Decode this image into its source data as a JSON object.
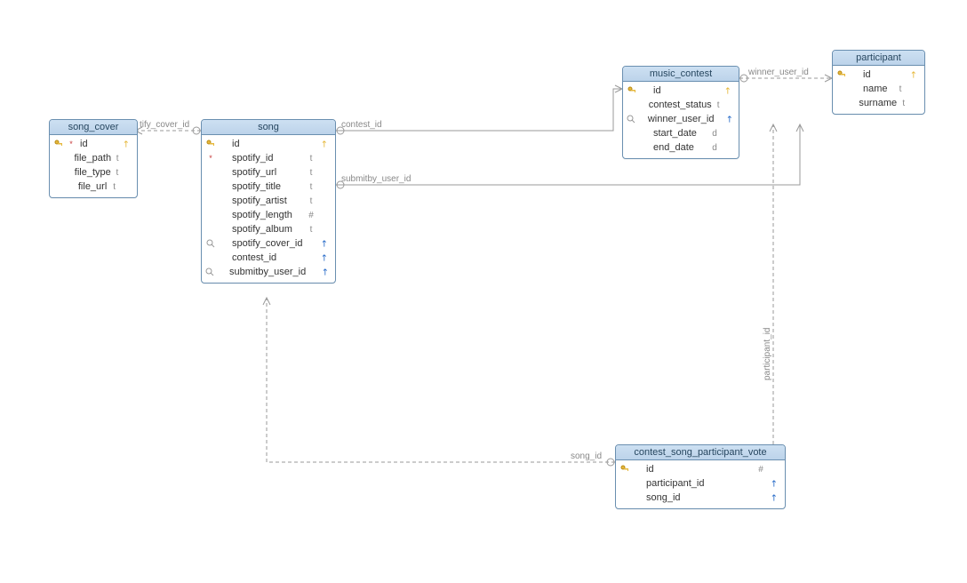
{
  "entities": {
    "song_cover": {
      "title": "song_cover",
      "columns": [
        {
          "name": "id",
          "type": "",
          "pk": true,
          "nn": true
        },
        {
          "name": "file_path",
          "type": "t"
        },
        {
          "name": "file_type",
          "type": "t"
        },
        {
          "name": "file_url",
          "type": "t"
        }
      ]
    },
    "song": {
      "title": "song",
      "columns": [
        {
          "name": "id",
          "type": "",
          "pk": true
        },
        {
          "name": "spotify_id",
          "type": "t",
          "nn": true
        },
        {
          "name": "spotify_url",
          "type": "t"
        },
        {
          "name": "spotify_title",
          "type": "t"
        },
        {
          "name": "spotify_artist",
          "type": "t"
        },
        {
          "name": "spotify_length",
          "type": "#"
        },
        {
          "name": "spotify_album",
          "type": "t"
        },
        {
          "name": "spotify_cover_id",
          "type": "",
          "fk": true,
          "idx": true
        },
        {
          "name": "contest_id",
          "type": "",
          "fk": true
        },
        {
          "name": "submitby_user_id",
          "type": "",
          "fk": true,
          "idx": true
        }
      ]
    },
    "music_contest": {
      "title": "music_contest",
      "columns": [
        {
          "name": "id",
          "type": "",
          "pk": true
        },
        {
          "name": "contest_status",
          "type": "t"
        },
        {
          "name": "winner_user_id",
          "type": "",
          "fk": true,
          "idx": true
        },
        {
          "name": "start_date",
          "type": "d"
        },
        {
          "name": "end_date",
          "type": "d"
        }
      ]
    },
    "participant": {
      "title": "participant",
      "columns": [
        {
          "name": "id",
          "type": "",
          "pk": true
        },
        {
          "name": "name",
          "type": "t"
        },
        {
          "name": "surname",
          "type": "t"
        }
      ]
    },
    "vote": {
      "title": "contest_song_participant_vote",
      "columns": [
        {
          "name": "id",
          "type": "#",
          "pk": true
        },
        {
          "name": "participant_id",
          "type": "",
          "fk": true
        },
        {
          "name": "song_id",
          "type": "",
          "fk": true
        }
      ]
    }
  },
  "edge_labels": {
    "spotify_cover_id": "tify_cover_id",
    "contest_id": "contest_id",
    "submitby_user_id": "submitby_user_id",
    "winner_user_id": "winner_user_id",
    "participant_id": "participant_id",
    "song_id": "song_id"
  }
}
